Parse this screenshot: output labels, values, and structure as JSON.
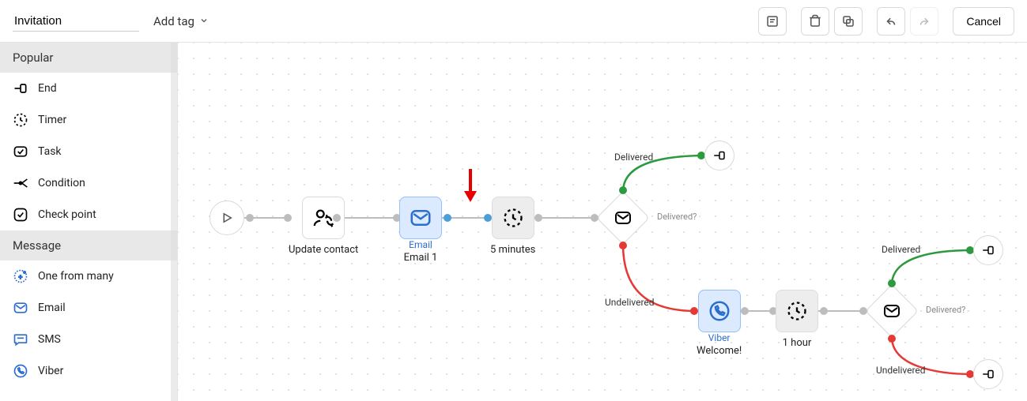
{
  "header": {
    "title_value": "Invitation",
    "add_tag_label": "Add tag",
    "cancel_label": "Cancel"
  },
  "sidebar": {
    "sections": [
      {
        "title": "Popular",
        "items": [
          {
            "label": "End"
          },
          {
            "label": "Timer"
          },
          {
            "label": "Task"
          },
          {
            "label": "Condition"
          },
          {
            "label": "Check point"
          }
        ]
      },
      {
        "title": "Message",
        "items": [
          {
            "label": "One from many"
          },
          {
            "label": "Email"
          },
          {
            "label": "SMS"
          },
          {
            "label": "Viber"
          }
        ]
      }
    ]
  },
  "flow": {
    "nodes": {
      "update_contact": {
        "label": "Update contact"
      },
      "email": {
        "type_label": "Email",
        "name": "Email 1"
      },
      "timer1": {
        "label": "5 minutes"
      },
      "cond1": {
        "label": "Delivered?"
      },
      "end1": {},
      "viber": {
        "type_label": "Viber",
        "name": "Welcome!"
      },
      "timer2": {
        "label": "1 hour"
      },
      "cond2": {
        "label": "Delivered?"
      },
      "end2": {},
      "end3": {}
    },
    "edges": {
      "delivered1": "Delivered",
      "undelivered1": "Undelivered",
      "delivered2": "Delivered",
      "undelivered2": "Undelivered"
    }
  }
}
